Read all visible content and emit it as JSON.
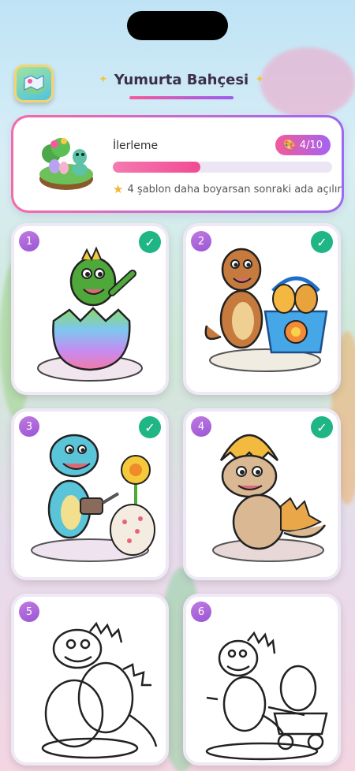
{
  "header": {
    "title": "Yumurta Bahçesi",
    "map_icon": "island-map-icon"
  },
  "progress": {
    "label": "İlerleme",
    "count_text": "4/10",
    "completed": 4,
    "total": 10,
    "hint": "4 şablon daha boyarsan sonraki ada açılır",
    "palette_icon": "palette-icon",
    "star_icon": "star-icon"
  },
  "colors": {
    "accent_pink": "#f25a9b",
    "accent_purple": "#9b5cf0",
    "check_green": "#1fb584"
  },
  "templates": [
    {
      "number": "1",
      "completed": true,
      "subject": "dino-in-egg"
    },
    {
      "number": "2",
      "completed": true,
      "subject": "dino-with-basket"
    },
    {
      "number": "3",
      "completed": true,
      "subject": "dino-watering-flower"
    },
    {
      "number": "4",
      "completed": true,
      "subject": "dino-eggshell-hat"
    },
    {
      "number": "5",
      "completed": false,
      "subject": "dino-hugging-egg"
    },
    {
      "number": "6",
      "completed": false,
      "subject": "dino-pulling-cart"
    }
  ]
}
